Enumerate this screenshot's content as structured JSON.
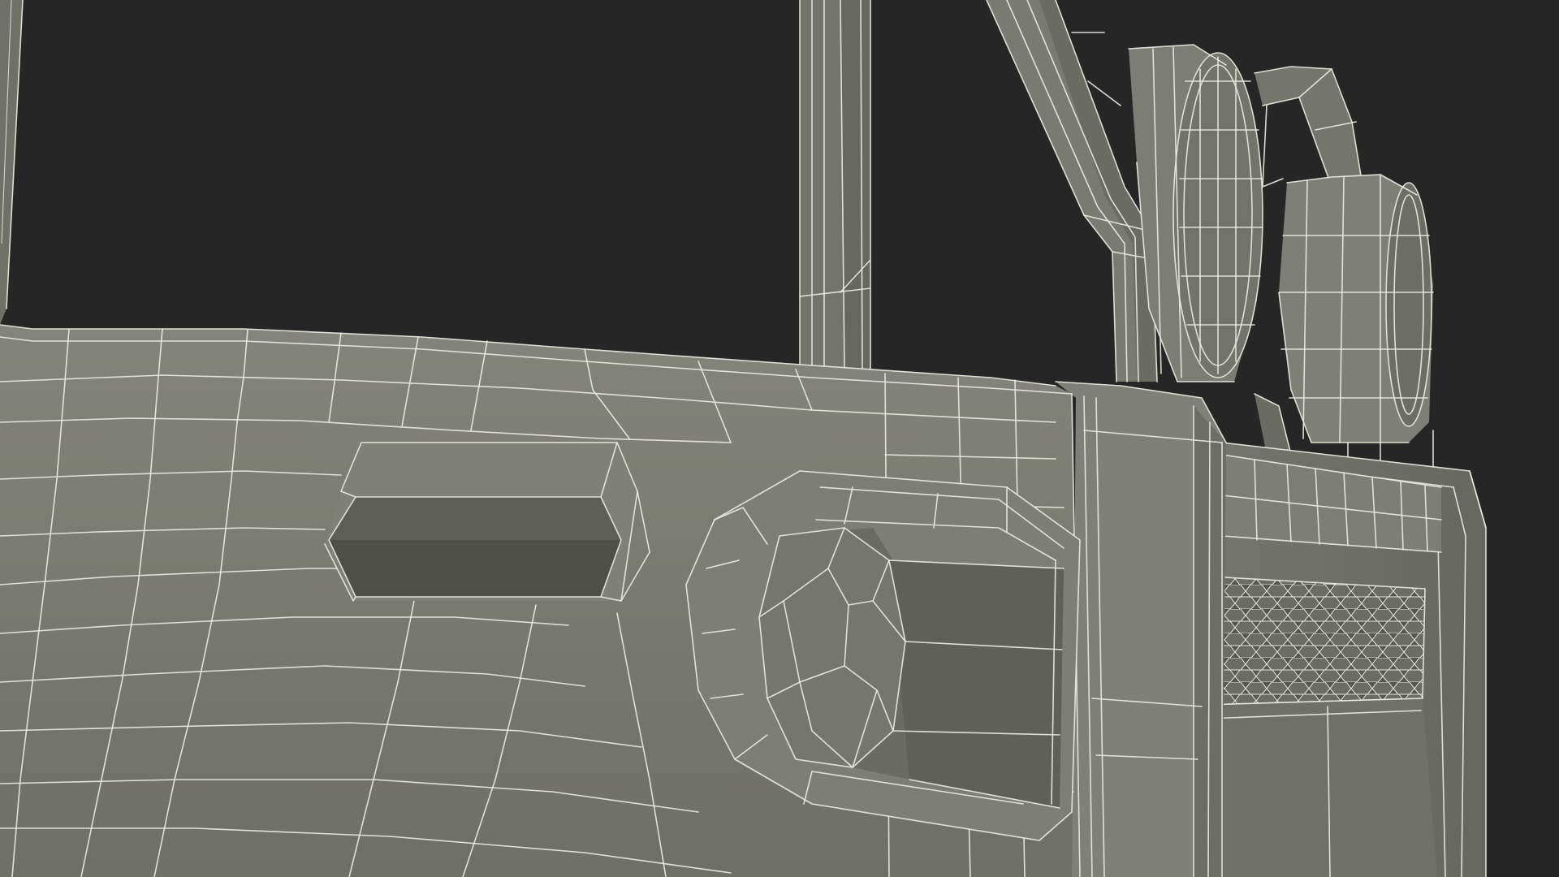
{
  "scene": {
    "subject": "wireframe-3d-model-render",
    "colors": {
      "background": "#262626",
      "surface": "#7b7c71",
      "surface_light": "#85867b",
      "surface_shadow": "#5e5f56",
      "surface_dark": "#4c4d45",
      "wire": "#e9e9e0"
    }
  }
}
